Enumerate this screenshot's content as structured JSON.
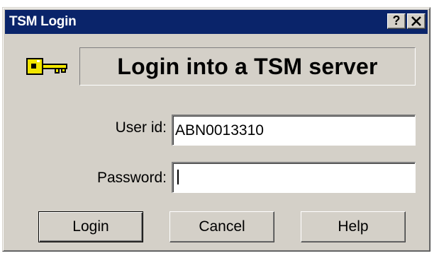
{
  "window": {
    "title": "TSM Login",
    "help_button": "?",
    "close_button": "✕"
  },
  "banner": {
    "text": "Login into a TSM server",
    "icon": "key-icon"
  },
  "form": {
    "user_id_label": "User id:",
    "user_id_value": "ABN0013310",
    "password_label": "Password:",
    "password_value": ""
  },
  "buttons": {
    "login": "Login",
    "cancel": "Cancel",
    "help": "Help"
  },
  "colors": {
    "titlebar": "#0a246a",
    "dialog_face": "#d4d0c8",
    "key_yellow": "#f2e600"
  }
}
